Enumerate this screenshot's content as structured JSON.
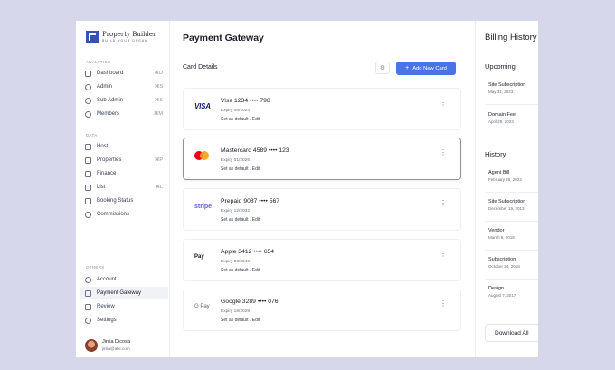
{
  "brand": {
    "name": "Property Builder",
    "tagline": "BUILD YOUR DREAM"
  },
  "sidebar": {
    "sections": {
      "analytics": "ANALYTICS",
      "data": "DATA",
      "others": "OTHERS"
    },
    "analytics_items": [
      {
        "label": "Dashboard",
        "shortcut": "⌘D"
      },
      {
        "label": "Admin",
        "shortcut": "⌘S"
      },
      {
        "label": "Sub Admin",
        "shortcut": "⌘S"
      },
      {
        "label": "Members",
        "shortcut": "⌘M"
      }
    ],
    "data_items": [
      {
        "label": "Host",
        "shortcut": ""
      },
      {
        "label": "Properties",
        "shortcut": "⌘P"
      },
      {
        "label": "Finance",
        "shortcut": ""
      },
      {
        "label": "List",
        "shortcut": "⌘L"
      },
      {
        "label": "Booking Status",
        "shortcut": ""
      },
      {
        "label": "Commissions",
        "shortcut": ""
      }
    ],
    "other_items": [
      {
        "label": "Account"
      },
      {
        "label": "Payment Gateway"
      },
      {
        "label": "Review"
      },
      {
        "label": "Settings"
      }
    ],
    "user": {
      "name": "Jinlia Dicosa",
      "email": "jinlia@abc.com"
    }
  },
  "main": {
    "title": "Payment Gateway",
    "section_label": "Card Details",
    "add_button": "Add New Card",
    "cards": [
      {
        "brand": "VISA",
        "title": "Visa 1234 •••• 798",
        "expiry": "Expiry 06/2024",
        "action": "Set as default . Edit"
      },
      {
        "brand": "mastercard",
        "title": "Mastercard 4589 •••• 123",
        "expiry": "Expiry 01/2026",
        "action": "Set as default . Edit"
      },
      {
        "brand": "stripe",
        "title": "Prepaid 9087 •••• 567",
        "expiry": "Expiry 12/2032",
        "action": "Set as default . Edit"
      },
      {
        "brand": " Pay",
        "title": "Apple 3412 •••• 654",
        "expiry": "Expiry 28/2040",
        "action": "Set as default . Edit"
      },
      {
        "brand": "G Pay",
        "title": "Google 3289 •••• 076",
        "expiry": "Expiry 18/2029",
        "action": "Set as default . Edit"
      }
    ]
  },
  "billing": {
    "title": "Billing History",
    "upcoming_label": "Upcoming",
    "upcoming": [
      {
        "name": "Site Subscription",
        "date": "May 31, 2023"
      },
      {
        "name": "Domain Fee",
        "date": "April 28, 2023"
      }
    ],
    "history_label": "History",
    "history": [
      {
        "name": "Agent Bill",
        "date": "February 28, 2023"
      },
      {
        "name": "Site Subscription",
        "date": "December 19, 2013"
      },
      {
        "name": "Vendor",
        "date": "March 6, 2018"
      },
      {
        "name": "Subscription",
        "date": "October 24, 2018"
      },
      {
        "name": "Design",
        "date": "August 7, 2017"
      }
    ],
    "download_button": "Download All"
  }
}
